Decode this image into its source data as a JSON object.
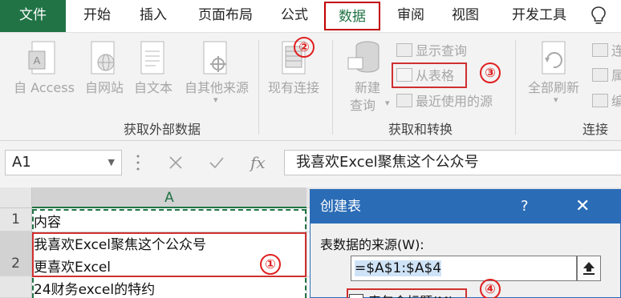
{
  "tabs": [
    "文件",
    "开始",
    "插入",
    "页面布局",
    "公式",
    "数据",
    "审阅",
    "视图",
    "开发工具"
  ],
  "ribbon": {
    "get_external_data": {
      "buttons": [
        "自 Access",
        "自网站",
        "自文本",
        "自其他来源"
      ],
      "group_label": "获取外部数据"
    },
    "existing_connections": "现有连接",
    "get_transform": {
      "new_query": [
        "新建",
        "查询"
      ],
      "small_items": [
        "显示查询",
        "从表格",
        "最近使用的源"
      ],
      "group_label": "获取和转换"
    },
    "connections": {
      "refresh_all": "全部刷新",
      "small_items": [
        "连",
        "属",
        "编"
      ],
      "group_label": "连接"
    }
  },
  "annotations": [
    "①",
    "②",
    "③",
    "④"
  ],
  "formula_bar": {
    "name_box": "A1",
    "fx": "fx",
    "formula": "我喜欢Excel聚焦这个公众号"
  },
  "sheet": {
    "column": "A",
    "rows": [
      {
        "num": "1",
        "lines": [
          "内容"
        ]
      },
      {
        "num": "2",
        "lines": [
          "我喜欢Excel聚焦这个公众号",
          "更喜欢Excel"
        ]
      },
      {
        "num": "",
        "lines": [
          "24财务excel的特约"
        ]
      }
    ]
  },
  "dialog": {
    "title": "创建表",
    "help": "?",
    "close": "✕",
    "source_label": "表数据的来源(W):",
    "range": "=$A$1:$A$4",
    "header_checkbox_label": "表包含标题(M)"
  },
  "colors": {
    "excel_green": "#217346",
    "annotation_red": "#e02020",
    "dialog_blue": "#2b6cb6"
  }
}
